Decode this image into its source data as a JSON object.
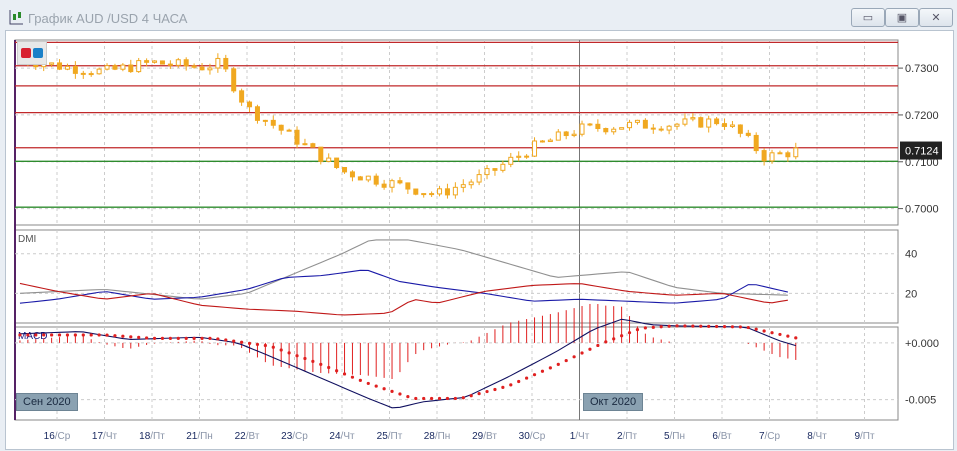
{
  "window": {
    "title": "График AUD /USD  4 ЧАСА",
    "buttons": [
      "minimize",
      "restore",
      "close"
    ]
  },
  "price_axis": {
    "ticks": [
      "0.7300",
      "0.7200",
      "0.7100",
      "0.7000"
    ],
    "current": "0.7124"
  },
  "dmi": {
    "label": "DMI",
    "ticks": [
      "40",
      "20"
    ]
  },
  "macd": {
    "label": "MACD",
    "ticks": [
      "+0.000",
      "-0.005"
    ]
  },
  "month_tags": [
    "Сен 2020",
    "Окт 2020"
  ],
  "x_labels": [
    [
      "16",
      "/Ср"
    ],
    [
      "17",
      "/Чт"
    ],
    [
      "18",
      "/Пт"
    ],
    [
      "21",
      "/Пн"
    ],
    [
      "22",
      "/Вт"
    ],
    [
      "23",
      "/Ср"
    ],
    [
      "24",
      "/Чт"
    ],
    [
      "25",
      "/Пт"
    ],
    [
      "28",
      "/Пн"
    ],
    [
      "29",
      "/Вт"
    ],
    [
      "30",
      "/Ср"
    ],
    [
      "1",
      "/Чт"
    ],
    [
      "2",
      "/Пт"
    ],
    [
      "5",
      "/Пн"
    ],
    [
      "6",
      "/Вт"
    ],
    [
      "7",
      "/Ср"
    ],
    [
      "8",
      "/Чт"
    ],
    [
      "9",
      "/Пт"
    ]
  ],
  "colors": {
    "candle": "#f0a820",
    "level_red": "#c0282a",
    "level_green": "#2e8b2e",
    "plus_di": "#1a1aa8",
    "minus_di": "#c01818",
    "adx": "#909090",
    "macd": "#101060",
    "signal": "#e02020"
  },
  "chart_data": {
    "type": "candlestick",
    "price_range": [
      0.6965,
      0.736
    ],
    "levels_red": [
      0.7355,
      0.7305,
      0.7262,
      0.7205,
      0.713
    ],
    "levels_green": [
      0.7101,
      0.7003
    ],
    "price_path": [
      [
        -0.78,
        0.732
      ],
      [
        0,
        0.7305
      ],
      [
        1,
        0.7292
      ],
      [
        2,
        0.7312
      ],
      [
        3,
        0.7302
      ],
      [
        3.45,
        0.731
      ],
      [
        4,
        0.7215
      ],
      [
        5,
        0.715
      ],
      [
        6,
        0.708
      ],
      [
        7,
        0.7055
      ],
      [
        8,
        0.703
      ],
      [
        9,
        0.707
      ],
      [
        10,
        0.713
      ],
      [
        11,
        0.717
      ],
      [
        12,
        0.7178
      ],
      [
        13,
        0.718
      ],
      [
        14,
        0.7188
      ],
      [
        14.5,
        0.715
      ],
      [
        14.9,
        0.711
      ],
      [
        15.6,
        0.7124
      ]
    ],
    "dmi_range": [
      5,
      52
    ],
    "adx": [
      [
        -0.78,
        20
      ],
      [
        1,
        22
      ],
      [
        3,
        17
      ],
      [
        4,
        20
      ],
      [
        5,
        30
      ],
      [
        6,
        40
      ],
      [
        6.6,
        47
      ],
      [
        7.4,
        47
      ],
      [
        8.5,
        42
      ],
      [
        9.5,
        35
      ],
      [
        10.5,
        28
      ],
      [
        11.5,
        30
      ],
      [
        12,
        31
      ],
      [
        13,
        23
      ],
      [
        14,
        20
      ],
      [
        15.5,
        19
      ]
    ],
    "plus_di": [
      [
        -0.78,
        15
      ],
      [
        0,
        17
      ],
      [
        1,
        21
      ],
      [
        2,
        17
      ],
      [
        3,
        18
      ],
      [
        4,
        22
      ],
      [
        4.8,
        28
      ],
      [
        5.6,
        29
      ],
      [
        6.5,
        32
      ],
      [
        7.2,
        26
      ],
      [
        8,
        23
      ],
      [
        9,
        20
      ],
      [
        10,
        16
      ],
      [
        11,
        17
      ],
      [
        12,
        16
      ],
      [
        13,
        15
      ],
      [
        14,
        17
      ],
      [
        14.6,
        25
      ],
      [
        15.5,
        20
      ]
    ],
    "minus_di": [
      [
        -0.78,
        25
      ],
      [
        0,
        21
      ],
      [
        1,
        17
      ],
      [
        2,
        20
      ],
      [
        3,
        14
      ],
      [
        4,
        12
      ],
      [
        5,
        11
      ],
      [
        6,
        9
      ],
      [
        7,
        10
      ],
      [
        7.5,
        17
      ],
      [
        8,
        15
      ],
      [
        9,
        21
      ],
      [
        10,
        24
      ],
      [
        11,
        25
      ],
      [
        12,
        21
      ],
      [
        13,
        19
      ],
      [
        14,
        20
      ],
      [
        15,
        15
      ],
      [
        15.5,
        17
      ]
    ],
    "macd_range": [
      -0.0068,
      0.0014
    ],
    "macd": [
      [
        -0.78,
        0.0008
      ],
      [
        0.5,
        0.001
      ],
      [
        1.5,
        0.0003
      ],
      [
        3,
        0.0005
      ],
      [
        3.8,
        0
      ],
      [
        4.5,
        -0.0012
      ],
      [
        5.5,
        -0.003
      ],
      [
        6.5,
        -0.0048
      ],
      [
        7.1,
        -0.0058
      ],
      [
        7.7,
        -0.0052
      ],
      [
        8.6,
        -0.0048
      ],
      [
        9.5,
        -0.003
      ],
      [
        10.5,
        -0.0008
      ],
      [
        11.3,
        0.0012
      ],
      [
        11.9,
        0.0021
      ],
      [
        12.5,
        0.0016
      ],
      [
        13,
        0.0015
      ],
      [
        14.5,
        0.0014
      ],
      [
        15.2,
        0.0002
      ],
      [
        15.6,
        -0.0003
      ]
    ],
    "signal": [
      [
        -0.78,
        0.0007
      ],
      [
        1,
        0.0007
      ],
      [
        2,
        0.0004
      ],
      [
        3.3,
        0.0004
      ],
      [
        4.5,
        -0.0003
      ],
      [
        5.5,
        -0.0018
      ],
      [
        6.5,
        -0.0035
      ],
      [
        7.5,
        -0.0049
      ],
      [
        8.5,
        -0.0049
      ],
      [
        9.5,
        -0.0038
      ],
      [
        10.5,
        -0.002
      ],
      [
        11.5,
        0.0
      ],
      [
        12.3,
        0.0013
      ],
      [
        13,
        0.0015
      ],
      [
        14.5,
        0.0014
      ],
      [
        15.6,
        0.0004
      ]
    ]
  }
}
